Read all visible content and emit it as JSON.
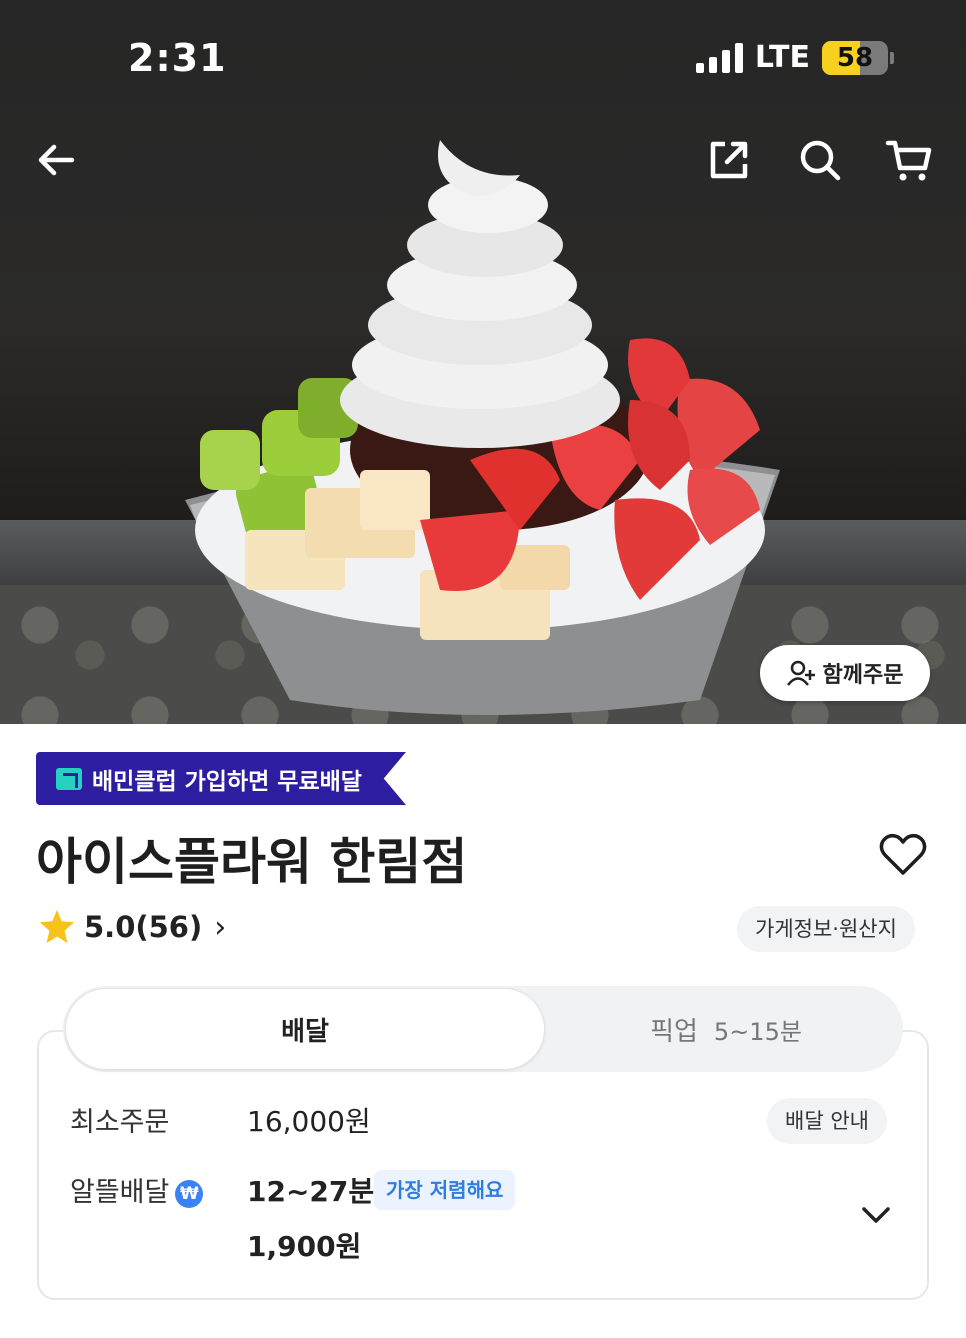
{
  "status_bar": {
    "time": "2:31",
    "network": "LTE",
    "battery": "58",
    "battery_level": 0.58
  },
  "hero": {
    "together_order_label": "함께주문"
  },
  "promo": {
    "label": "배민클럽 가입하면 무료배달"
  },
  "store": {
    "name": "아이스플라워 한림점",
    "rating": "5.0",
    "review_count": "(56)",
    "info_label": "가게정보·원산지"
  },
  "tabs": {
    "delivery": "배달",
    "pickup": "픽업",
    "pickup_time": "5~15분"
  },
  "delivery": {
    "min_order_label": "최소주문",
    "min_order_value": "16,000원",
    "guide_label": "배달 안내",
    "type_label": "알뜰배달",
    "time": "12~27분",
    "badge": "가장 저렴해요",
    "fee": "1,900원"
  },
  "colors": {
    "promo_bg": "#2c1da1",
    "star": "#f7c21a",
    "badge_text": "#2f7de1"
  },
  "icons": [
    "back-arrow-icon",
    "share-icon",
    "search-icon",
    "cart-icon",
    "add-person-icon",
    "heart-icon",
    "star-icon",
    "chevron-right-icon",
    "won-icon",
    "chevron-down-icon"
  ]
}
